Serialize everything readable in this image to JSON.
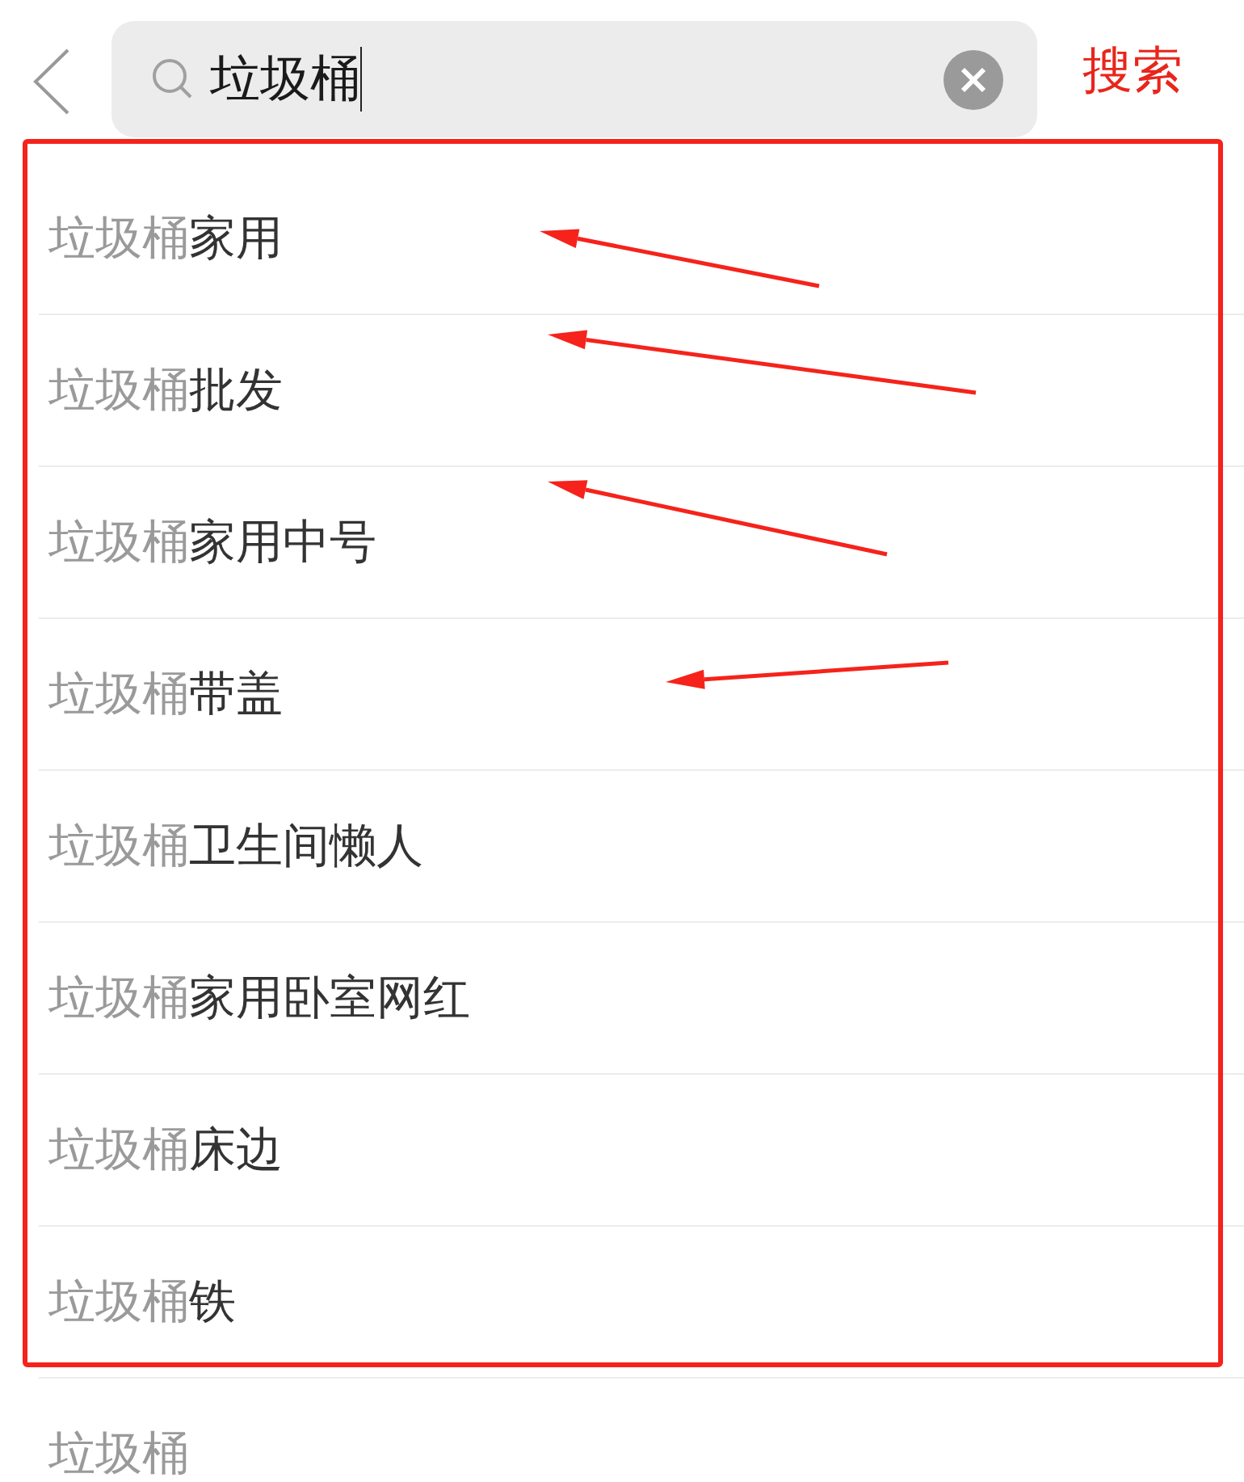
{
  "search_bar": {
    "value": "垃圾桶",
    "focused": true,
    "action": "搜索"
  },
  "highlighted_suggestions": [
    {
      "match": "垃圾桶",
      "rest": "家用",
      "arrow": true
    },
    {
      "match": "垃圾桶",
      "rest": "批发",
      "arrow": true
    },
    {
      "match": "垃圾桶",
      "rest": "家用中号",
      "arrow": true
    },
    {
      "match": "垃圾桶",
      "rest": "带盖",
      "arrow": true
    },
    {
      "match": "垃圾桶",
      "rest": "卫生间懒人",
      "arrow": false
    },
    {
      "match": "垃圾桶",
      "rest": "家用卧室网红",
      "arrow": false
    },
    {
      "match": "垃圾桶",
      "rest": "床边",
      "arrow": false
    },
    {
      "match": "垃圾桶",
      "rest": "铁",
      "arrow": false
    }
  ],
  "other_suggestions": [
    {
      "match": "垃圾桶",
      "arrow": false
    }
  ]
}
